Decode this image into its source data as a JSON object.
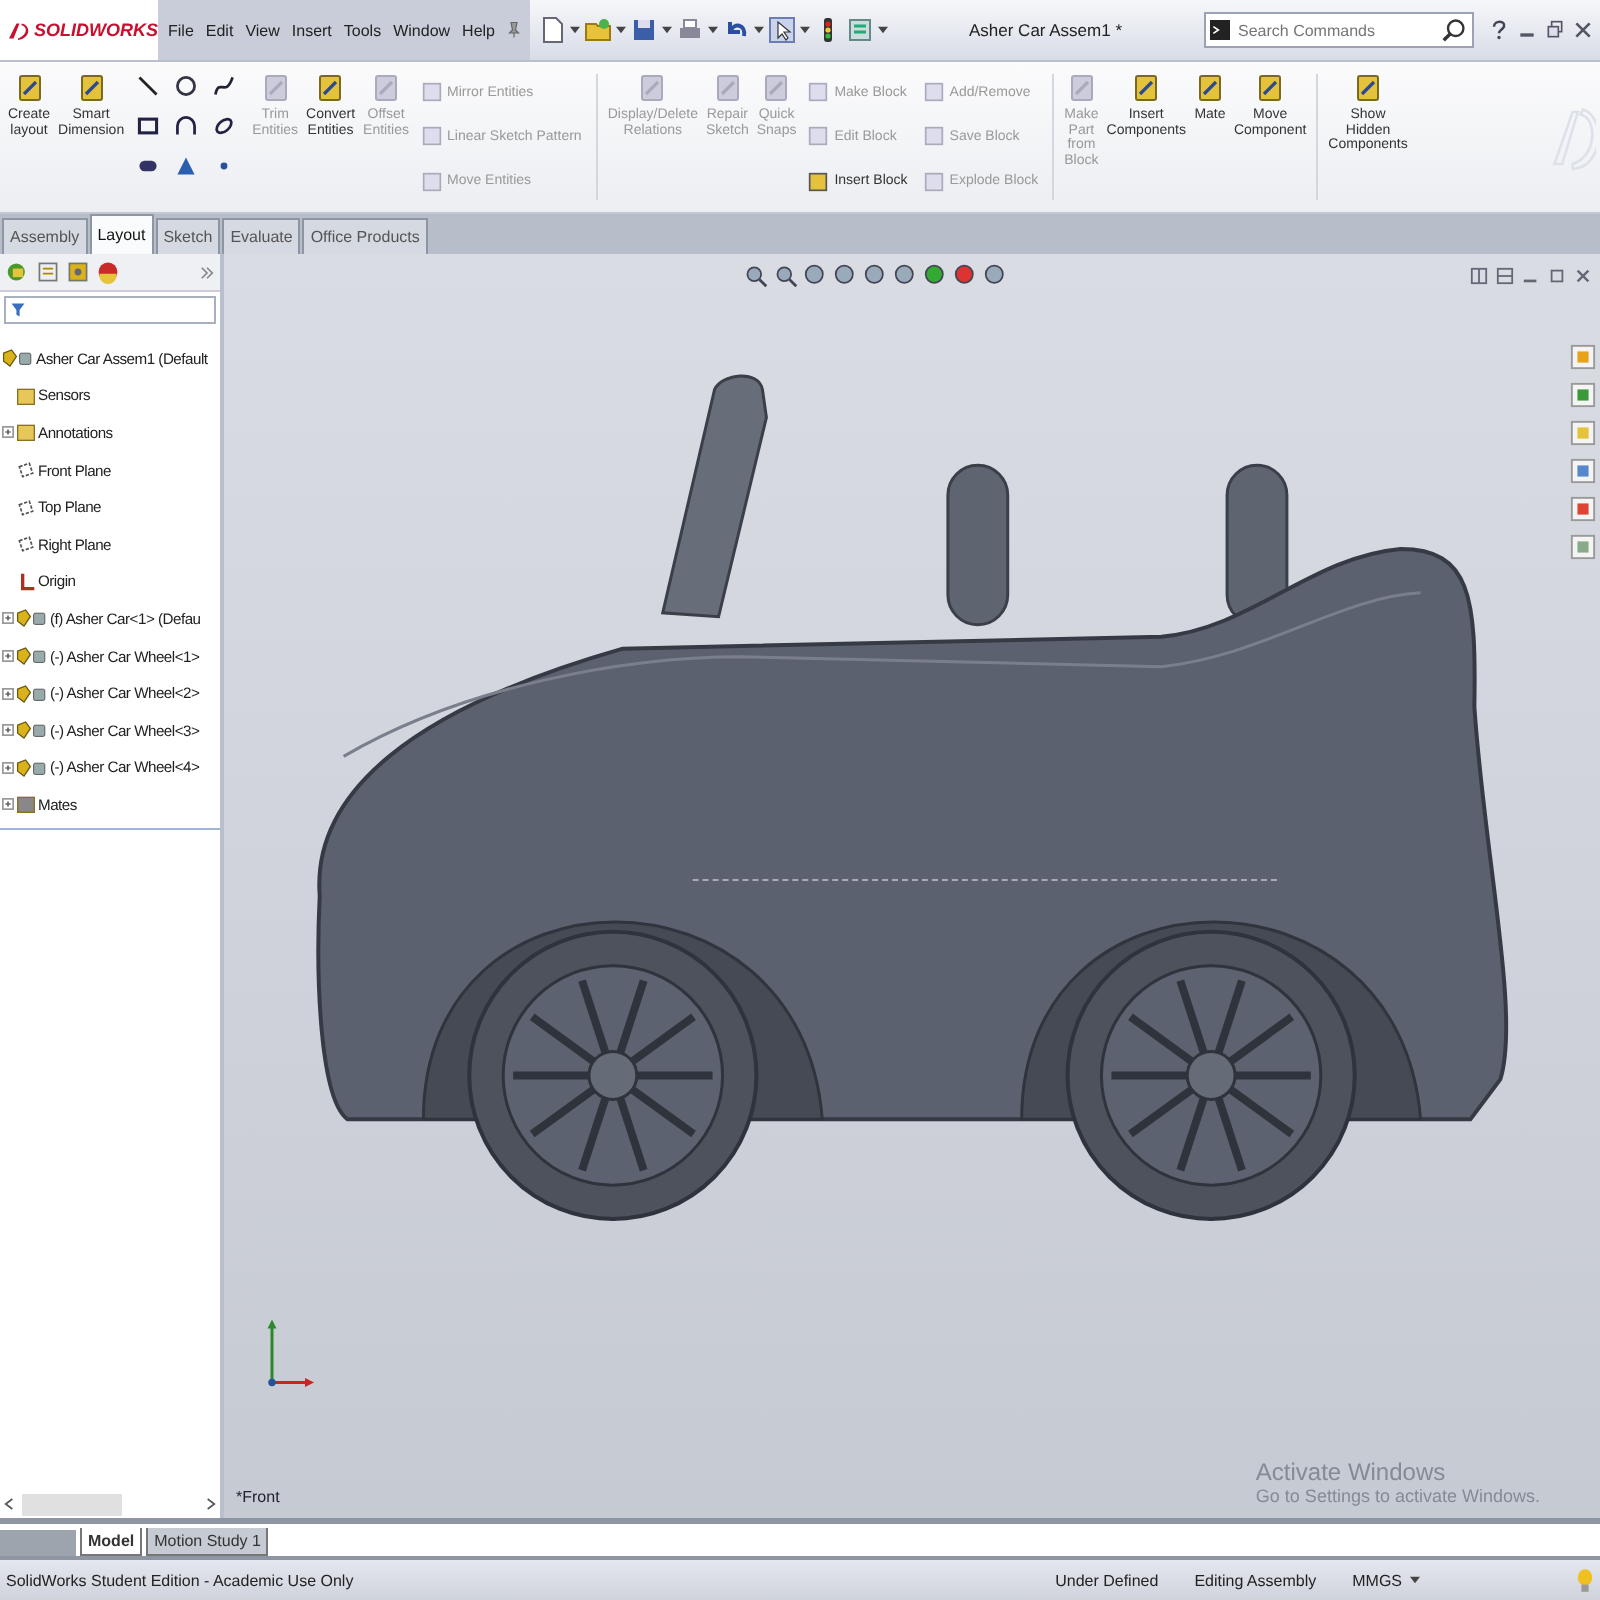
{
  "app": {
    "logo": "SOLIDWORKS"
  },
  "menu": [
    "File",
    "Edit",
    "View",
    "Insert",
    "Tools",
    "Window",
    "Help"
  ],
  "title": "Asher Car Assem1 *",
  "search": {
    "placeholder": "Search Commands"
  },
  "ribbon": [
    {
      "kind": "large",
      "label": "Create layout",
      "disabled": false
    },
    {
      "kind": "large",
      "label": "Smart Dimension",
      "disabled": false
    },
    {
      "kind": "sketch-grid"
    },
    {
      "kind": "large",
      "label": "Trim Entities",
      "disabled": true
    },
    {
      "kind": "large",
      "label": "Convert Entities",
      "disabled": false
    },
    {
      "kind": "large",
      "label": "Offset Entities",
      "disabled": true
    },
    {
      "kind": "stack",
      "items": [
        {
          "label": "Mirror Entities",
          "disabled": true
        },
        {
          "label": "Linear Sketch Pattern",
          "disabled": true
        },
        {
          "label": "Move Entities",
          "disabled": true
        }
      ]
    },
    {
      "kind": "separator"
    },
    {
      "kind": "large",
      "label": "Display/Delete Relations",
      "disabled": true
    },
    {
      "kind": "large",
      "label": "Repair Sketch",
      "disabled": true
    },
    {
      "kind": "large",
      "label": "Quick Snaps",
      "disabled": true
    },
    {
      "kind": "stack",
      "items": [
        {
          "label": "Make Block",
          "disabled": true
        },
        {
          "label": "Edit Block",
          "disabled": true
        },
        {
          "label": "Insert Block",
          "disabled": false
        }
      ]
    },
    {
      "kind": "stack",
      "items": [
        {
          "label": "Add/Remove",
          "disabled": true
        },
        {
          "label": "Save Block",
          "disabled": true
        },
        {
          "label": "Explode Block",
          "disabled": true
        }
      ]
    },
    {
      "kind": "separator"
    },
    {
      "kind": "large",
      "label": "Make Part from Block",
      "disabled": true
    },
    {
      "kind": "large",
      "label": "Insert Components",
      "disabled": false
    },
    {
      "kind": "large",
      "label": "Mate",
      "disabled": false
    },
    {
      "kind": "large",
      "label": "Move Component",
      "disabled": false
    },
    {
      "kind": "separator"
    },
    {
      "kind": "large",
      "label": "Show Hidden Components",
      "disabled": false
    }
  ],
  "tabs": [
    {
      "label": "Assembly",
      "selected": false
    },
    {
      "label": "Layout",
      "selected": true
    },
    {
      "label": "Sketch",
      "selected": false
    },
    {
      "label": "Evaluate",
      "selected": false
    },
    {
      "label": "Office Products",
      "selected": false
    }
  ],
  "tree": {
    "label": "Asher Car Assem1  (Default",
    "kind": "assembly",
    "children": [
      {
        "label": "Sensors",
        "kind": "sensors"
      },
      {
        "label": "Annotations",
        "kind": "annotations",
        "expanded": false
      },
      {
        "label": "Front Plane",
        "kind": "plane"
      },
      {
        "label": "Top Plane",
        "kind": "plane"
      },
      {
        "label": "Right Plane",
        "kind": "plane"
      },
      {
        "label": "Origin",
        "kind": "origin"
      },
      {
        "label": "(f) Asher Car<1> (Defau",
        "kind": "part",
        "expanded": false
      },
      {
        "label": "(-) Asher Car Wheel<1>",
        "kind": "part",
        "expanded": false
      },
      {
        "label": "(-) Asher Car Wheel<2>",
        "kind": "part",
        "expanded": false
      },
      {
        "label": "(-) Asher Car Wheel<3>",
        "kind": "part",
        "expanded": false
      },
      {
        "label": "(-) Asher Car Wheel<4>",
        "kind": "part",
        "expanded": false
      },
      {
        "label": "Mates",
        "kind": "mates",
        "expanded": false
      }
    ]
  },
  "view_label": "*Front",
  "activation": {
    "title": "Activate Windows",
    "hint": "Go to Settings to activate Windows."
  },
  "bottom_tabs": [
    {
      "label": "Model",
      "selected": true
    },
    {
      "label": "Motion Study 1",
      "selected": false
    }
  ],
  "status": {
    "edition": "SolidWorks Student Edition - Academic Use Only",
    "items": [
      "Under Defined",
      "Editing Assembly",
      "MMGS"
    ]
  }
}
